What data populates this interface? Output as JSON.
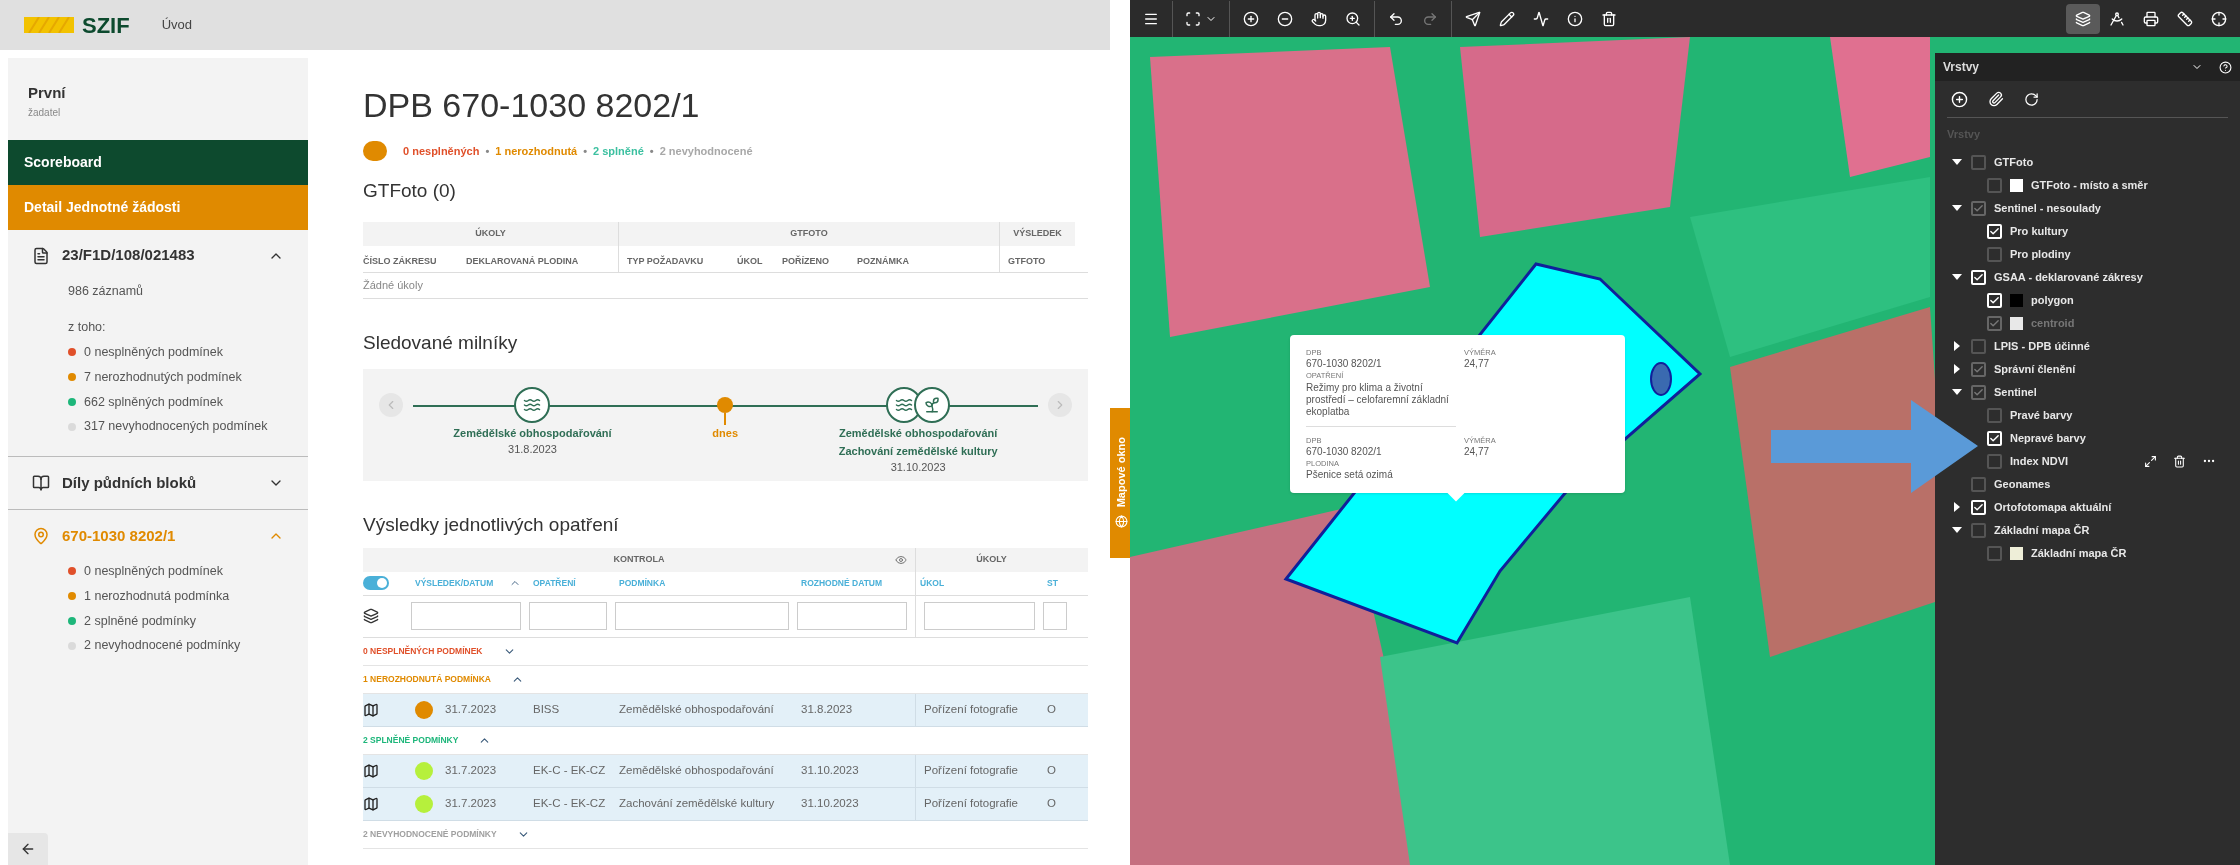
{
  "header": {
    "logo": "SZIF",
    "nav": "Úvod"
  },
  "sidebar": {
    "user": "První",
    "role": "žadatel",
    "menu": [
      {
        "label": "Scoreboard",
        "selected": false
      },
      {
        "label": "Detail Jednotné žádosti",
        "selected": true
      }
    ],
    "sections": [
      {
        "kind": "document",
        "title": "23/F1D/108/021483",
        "expanded": true,
        "count": "986 záznamů",
        "subtitle": "z toho:",
        "stats": [
          {
            "text": "0 nesplněných podmínek",
            "color": "#e0502a"
          },
          {
            "text": "7 nerozhodnutých podmínek",
            "color": "#e08a00"
          },
          {
            "text": "662 splněných podmínek",
            "color": "#1db67a"
          },
          {
            "text": "317 nevyhodnocených podmínek",
            "color": "#dadada"
          }
        ]
      },
      {
        "kind": "blocks",
        "title": "Díly půdních bloků",
        "expanded": false
      },
      {
        "kind": "location",
        "title": "670-1030 8202/1",
        "expanded": true,
        "stats": [
          {
            "text": "0 nesplněných podmínek",
            "color": "#e0502a"
          },
          {
            "text": "1 nerozhodnutá podmínka",
            "color": "#e08a00"
          },
          {
            "text": "2 splněné podmínky",
            "color": "#1db67a"
          },
          {
            "text": "2 nevyhodnocené podmínky",
            "color": "#dadada"
          }
        ]
      }
    ]
  },
  "detail": {
    "title": "DPB 670-1030 8202/1",
    "status": {
      "color": "#e08a00"
    },
    "summary": [
      {
        "text": "0 nesplněných",
        "color": "#e0502a"
      },
      {
        "separator": "•",
        "text": "1 nerozhodnutá",
        "color": "#e08a00"
      },
      {
        "separator": "•",
        "text": "2 splněné",
        "color": "#3cc0a0"
      },
      {
        "separator": "•",
        "text": "2 nevyhodnocené",
        "color": "#a8a8a8"
      }
    ],
    "gtfoto": {
      "title": "GTFoto (0)",
      "groups": [
        {
          "label": "ÚKOLY",
          "columns": [
            "ČÍSLO ZÁKRESU",
            "DEKLAROVANÁ PLODINA"
          ]
        },
        {
          "label": "GTFOTO",
          "columns": [
            "TYP POŽADAVKU",
            "ÚKOL",
            "POŘÍZENO",
            "POZNÁMKA"
          ]
        },
        {
          "label": "VÝSLEDEK",
          "columns": [
            "GTFOTO"
          ]
        }
      ],
      "empty": "Žádné úkoly"
    },
    "milestones": {
      "title": "Sledované milníky",
      "items": [
        {
          "kind": "milestone",
          "labels": [
            "Zemědělské obhospodařování"
          ],
          "date": "31.8.2023"
        },
        {
          "kind": "today",
          "label": "dnes"
        },
        {
          "kind": "milestone",
          "labels": [
            "Zemědělské obhospodařování",
            "Zachování zemědělské kultury"
          ],
          "date": "31.10.2023"
        }
      ]
    },
    "results": {
      "title": "Výsledky jednotlivých opatření",
      "toggle_on": true,
      "groups": [
        {
          "label": "KONTROLA",
          "columns": [
            "VÝSLEDEK/DATUM",
            "OPATŘENÍ",
            "PODMÍNKA",
            "ROZHODNÉ DATUM"
          ]
        },
        {
          "label": "ÚKOLY",
          "columns": [
            "ÚKOL",
            "ST"
          ]
        }
      ],
      "sections": [
        {
          "label": "0 NESPLNĚNÝCH PODMÍNEK",
          "color": "#e0502a",
          "expanded": false
        },
        {
          "label": "1 NEROZHODNUTÁ PODMÍNKA",
          "color": "#e08a00",
          "expanded": true,
          "rows": [
            {
              "color": "#e08a00",
              "date": "31.7.2023",
              "measure": "BISS",
              "condition": "Zemědělské obhospodařování",
              "decision_date": "31.8.2023",
              "task": "Pořízení fotografie",
              "status": "O"
            }
          ]
        },
        {
          "label": "2 SPLNĚNÉ PODMÍNKY",
          "color": "#1db67a",
          "expanded": true,
          "rows": [
            {
              "color": "#b6f03c",
              "date": "31.7.2023",
              "measure": "EK-C - EK-CZ",
              "condition": "Zemědělské obhospodařování",
              "decision_date": "31.10.2023",
              "task": "Pořízení fotografie",
              "status": "O"
            },
            {
              "color": "#b6f03c",
              "date": "31.7.2023",
              "measure": "EK-C - EK-CZ",
              "condition": "Zachování zemědělské kultury",
              "decision_date": "31.10.2023",
              "task": "Pořízení fotografie",
              "status": "O"
            }
          ]
        },
        {
          "label": "2 NEVYHODNOCENÉ PODMÍNKY",
          "color": "#a0a0a0",
          "expanded": false
        }
      ]
    }
  },
  "map_tab": "Mapové okno",
  "map_toolbar": {
    "redo_disabled": true,
    "layers_selected": true
  },
  "popup": {
    "sections": [
      {
        "fields": [
          {
            "label": "DPB",
            "value": "670-1030 8202/1"
          },
          {
            "label": "VÝMĚRA",
            "value": "24,77"
          },
          {
            "label": "OPATŘENÍ",
            "value": "Režimy pro klima a životní prostředí – celofaremní základní ekoplatba"
          }
        ]
      },
      {
        "fields": [
          {
            "label": "DPB",
            "value": "670-1030 8202/1"
          },
          {
            "label": "VÝMĚRA",
            "value": "24,77"
          },
          {
            "label": "PLODINA",
            "value": "Pšenice setá ozimá"
          }
        ]
      }
    ]
  },
  "layers_panel": {
    "title": "Vrstvy",
    "section": "Vrstvy",
    "layers": [
      {
        "kind": "group",
        "label": "GTFoto",
        "checked": false,
        "disabled": false,
        "expanded": true,
        "children": [
          {
            "label": "GTFoto - místo a směr",
            "checked": false,
            "disabled": false,
            "hovered": false,
            "color": "#ffffff"
          }
        ]
      },
      {
        "kind": "group",
        "label": "Sentinel - nesoulady",
        "checked": true,
        "disabled": true,
        "expanded": true,
        "children": [
          {
            "label": "Pro kultury",
            "checked": true,
            "disabled": false,
            "hovered": false
          },
          {
            "label": "Pro plodiny",
            "checked": false,
            "disabled": false,
            "hovered": false
          }
        ]
      },
      {
        "kind": "group",
        "label": "GSAA - deklarované zákresy",
        "checked": true,
        "disabled": false,
        "expanded": true,
        "children": [
          {
            "label": "polygon",
            "checked": true,
            "disabled": false,
            "hovered": false,
            "color": "#000000"
          },
          {
            "label": "centroid",
            "checked": true,
            "disabled": true,
            "hovered": false,
            "color": "#e8e8e8"
          }
        ]
      },
      {
        "kind": "group",
        "label": "LPIS - DPB účinné",
        "checked": false,
        "disabled": false,
        "expanded": false
      },
      {
        "kind": "group",
        "label": "Správní členění",
        "checked": true,
        "disabled": true,
        "expanded": false
      },
      {
        "kind": "group",
        "label": "Sentinel",
        "checked": true,
        "disabled": true,
        "expanded": true,
        "children": [
          {
            "label": "Pravé barvy",
            "checked": false,
            "disabled": false,
            "hovered": false
          },
          {
            "label": "Nepravé barvy",
            "checked": true,
            "disabled": false,
            "hovered": false
          },
          {
            "label": "Index NDVI",
            "checked": false,
            "disabled": false,
            "hovered": true
          }
        ]
      },
      {
        "kind": "layer",
        "label": "Geonames",
        "checked": false,
        "disabled": false
      },
      {
        "kind": "group",
        "label": "Ortofotomapa aktuální",
        "checked": true,
        "disabled": false,
        "expanded": false
      },
      {
        "kind": "group",
        "label": "Základní mapa ČR",
        "checked": false,
        "disabled": false,
        "expanded": true,
        "children": [
          {
            "label": "Základní mapa ČR",
            "checked": false,
            "disabled": false,
            "hovered": false,
            "color": "#eeeed8"
          }
        ]
      }
    ]
  }
}
